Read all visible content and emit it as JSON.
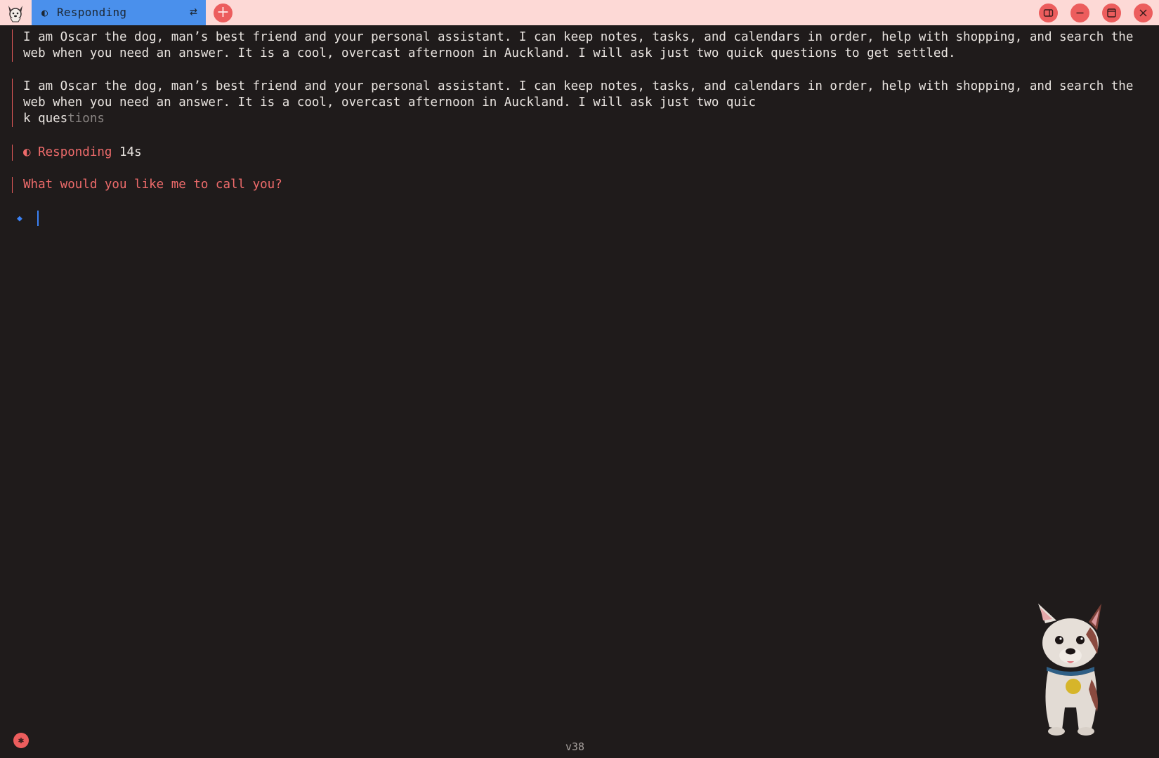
{
  "titlebar": {
    "tab": {
      "icon": "half-circle-icon",
      "label": "Responding",
      "swap_icon": "swap-icon"
    },
    "new_tab_icon": "plus-icon",
    "window_buttons": [
      "side-panel-icon",
      "minimize-icon",
      "maximize-icon",
      "close-icon"
    ]
  },
  "conversation": {
    "message1": "I am Oscar the dog, man’s best friend and your personal assistant. I can keep notes, tasks, and calendars in order, help with shopping, and search the web when you need an answer. It is a cool, overcast afternoon in Auckland. I will ask just two quick questions to get settled.",
    "message2_main": "I am Oscar the dog, man’s best friend and your personal assistant. I can keep notes, tasks, and calendars in order, help with shopping, and search the web when you need an answer. It is a cool, overcast afternoon in Auckland. I will ask just two quic",
    "message2_tail_solid": "k ques",
    "message2_tail_faded": "tions",
    "status": {
      "label": "Responding",
      "elapsed": "14s"
    },
    "question": "What would you like me to call you?"
  },
  "input": {
    "prompt_icon": "diamond-icon",
    "value": ""
  },
  "footer": {
    "version": "v38",
    "debug_icon": "bug-icon"
  },
  "colors": {
    "titlebar_bg": "#fdd9d6",
    "tab_bg": "#4a90ec",
    "accent_red": "#ec5d5d",
    "background": "#1f1b1b",
    "text": "#e9e4e0",
    "prompt_blue": "#3b82f6"
  }
}
